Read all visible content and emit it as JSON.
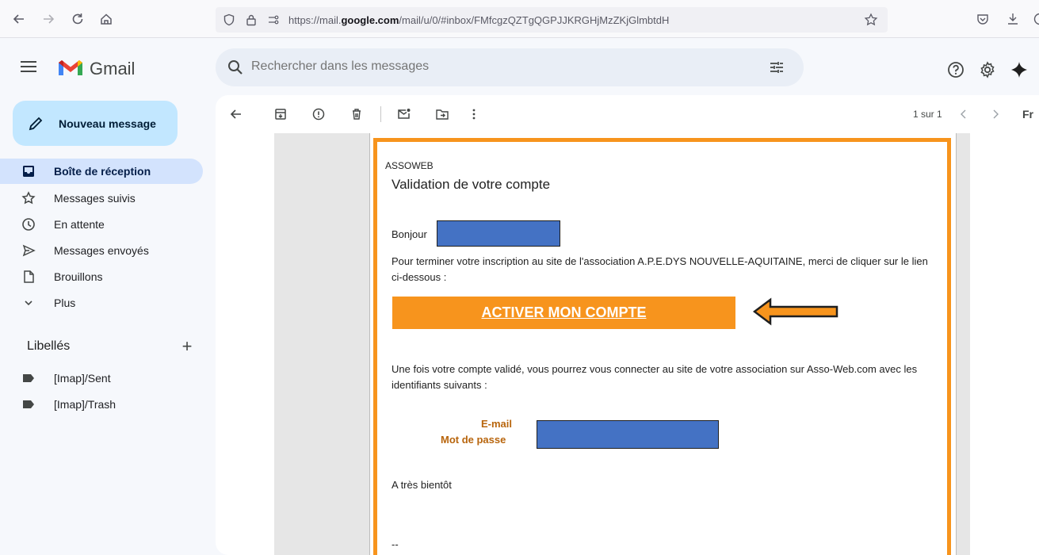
{
  "browser": {
    "url_prefix": "https://mail.",
    "url_domain": "google.com",
    "url_rest": "/mail/u/0/#inbox/FMfcgzQZTgQGPJJKRGHjMzZKjGlmbtdH"
  },
  "header": {
    "app_name": "Gmail",
    "search_placeholder": "Rechercher dans les messages"
  },
  "sidebar": {
    "compose_label": "Nouveau message",
    "items": [
      {
        "label": "Boîte de réception",
        "icon": "inbox-icon"
      },
      {
        "label": "Messages suivis",
        "icon": "star-icon"
      },
      {
        "label": "En attente",
        "icon": "clock-icon"
      },
      {
        "label": "Messages envoyés",
        "icon": "send-icon"
      },
      {
        "label": "Brouillons",
        "icon": "draft-icon"
      },
      {
        "label": "Plus",
        "icon": "chevron-down-icon"
      }
    ],
    "labels_title": "Libellés",
    "labels": [
      {
        "label": "[Imap]/Sent",
        "icon": "label-icon"
      },
      {
        "label": "[Imap]/Trash",
        "icon": "label-icon"
      }
    ]
  },
  "toolbar": {
    "pager": "1 sur 1",
    "lang_initials": "Fr"
  },
  "email": {
    "brand": "ASSOWEB",
    "title": "Validation de votre compte",
    "greeting": "Bonjour",
    "intro": "Pour terminer votre inscription au site de l'association A.P.E.DYS NOUVELLE-AQUITAINE, merci de cliquer sur le lien ci-dessous :",
    "cta_label": "ACTIVER MON COMPTE",
    "after_validation": "Une fois votre compte validé, vous pourrez vous connecter au site de votre association sur Asso-Web.com avec les identifiants suivants :",
    "email_label": "E-mail",
    "password_label": "Mot de passe",
    "signoff": "A très bientôt",
    "signature_sep": "--"
  },
  "colors": {
    "accent": "#f7941d",
    "redaction": "#4472c4",
    "compose_bg": "#c2e7ff",
    "active_item_bg": "#d3e3fd"
  }
}
